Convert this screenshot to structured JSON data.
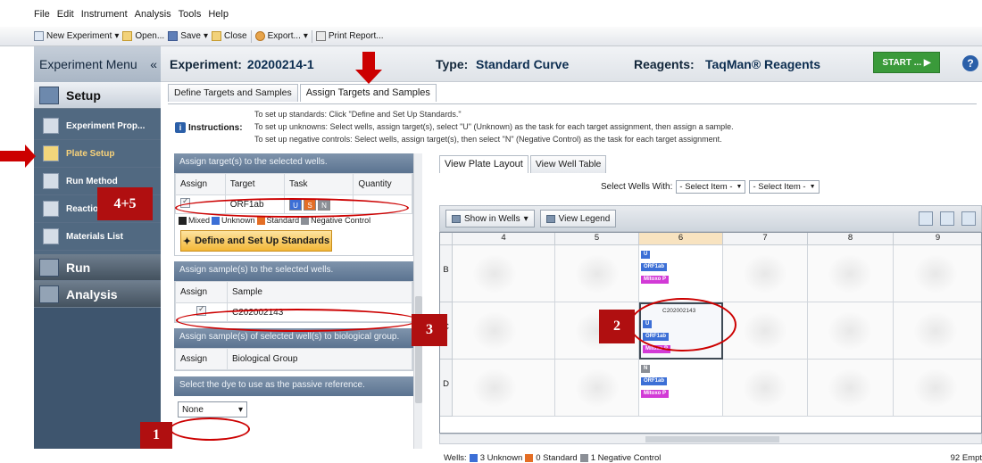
{
  "menubar": {
    "items": [
      "File",
      "Edit",
      "Instrument",
      "Analysis",
      "Tools",
      "Help"
    ]
  },
  "toolbar": {
    "new_label": "New Experiment",
    "open_label": "Open...",
    "save_label": "Save",
    "close_label": "Close",
    "export_label": "Export...",
    "print_label": "Print Report..."
  },
  "sidebar": {
    "title": "Experiment Menu",
    "collapse": "«",
    "setup": "Setup",
    "items": [
      "Experiment Prop...",
      "Plate Setup",
      "Run Method",
      "Reactio",
      "Materials List"
    ],
    "run": "Run",
    "analysis": "Analysis"
  },
  "header": {
    "exp_label": "Experiment:",
    "exp_value": "20200214-1",
    "type_label": "Type:",
    "type_value": "Standard Curve",
    "reagents_label": "Reagents:",
    "reagents_value": "TaqMan® Reagents",
    "start_label": "START ... ▶",
    "help": "?"
  },
  "subtabs": [
    "Define Targets and Samples",
    "Assign Targets and Samples"
  ],
  "instructions": {
    "label": "Instructions:",
    "lines": [
      "To set up standards: Click \"Define and Set Up Standards.\"",
      "To set up unknowns: Select wells, assign target(s), select \"U\" (Unknown) as the task for each target assignment, then assign a sample.",
      "To set up negative controls: Select wells, assign target(s), then select \"N\" (Negative Control) as the task for each target assignment."
    ]
  },
  "left": {
    "targets_header": "Assign target(s) to the selected wells.",
    "targets_cols": [
      "Assign",
      "Target",
      "Task",
      "Quantity"
    ],
    "target_row": {
      "target": "ORF1ab",
      "tasks": [
        "U",
        "S",
        "N"
      ]
    },
    "legend": [
      "Mixed",
      "Unknown",
      "Standard",
      "Negative Control"
    ],
    "define_btn": "Define and Set Up Standards",
    "samples_header": "Assign sample(s) to the selected wells.",
    "samples_cols": [
      "Assign",
      "Sample"
    ],
    "sample_row": "C202002143",
    "bio_header": "Assign sample(s) of selected well(s) to biological group.",
    "bio_cols": [
      "Assign",
      "Biological Group"
    ],
    "dye_header": "Select the dye to use as the passive reference.",
    "dye_value": "None"
  },
  "right": {
    "tabs": [
      "View Plate Layout",
      "View Well Table"
    ],
    "select_label": "Select Wells With:",
    "select1": "- Select Item -",
    "select2": "- Select Item -",
    "show_btn": "Show in Wells",
    "legend_btn": "View Legend",
    "cols": [
      "4",
      "5",
      "6",
      "7",
      "8",
      "9"
    ],
    "rows": [
      "B",
      "C",
      "D"
    ],
    "well_b6": {
      "tags": [
        "U",
        "ORF1ab",
        "Mitoxo P"
      ]
    },
    "well_c6": {
      "name": "C202002143",
      "tags": [
        "U",
        "ORF1ab",
        "Mitoxo P"
      ]
    },
    "well_d6": {
      "tags": [
        "N",
        "ORF1ab",
        "Mitoxo P"
      ]
    },
    "status_prefix": "Wells:",
    "status_unknown": "3 Unknown",
    "status_standard": "0 Standard",
    "status_neg": "1 Negative Control",
    "status_empty": "92 Empt"
  },
  "callouts": [
    "4+5",
    "3",
    "2",
    "1"
  ],
  "colors": {
    "accent_red": "#b00f10",
    "sidebar": "#3e556e",
    "unknown": "#3c6fd6",
    "standard": "#e46e25",
    "negative": "#8b8f96",
    "mix": "#d23ad6"
  }
}
